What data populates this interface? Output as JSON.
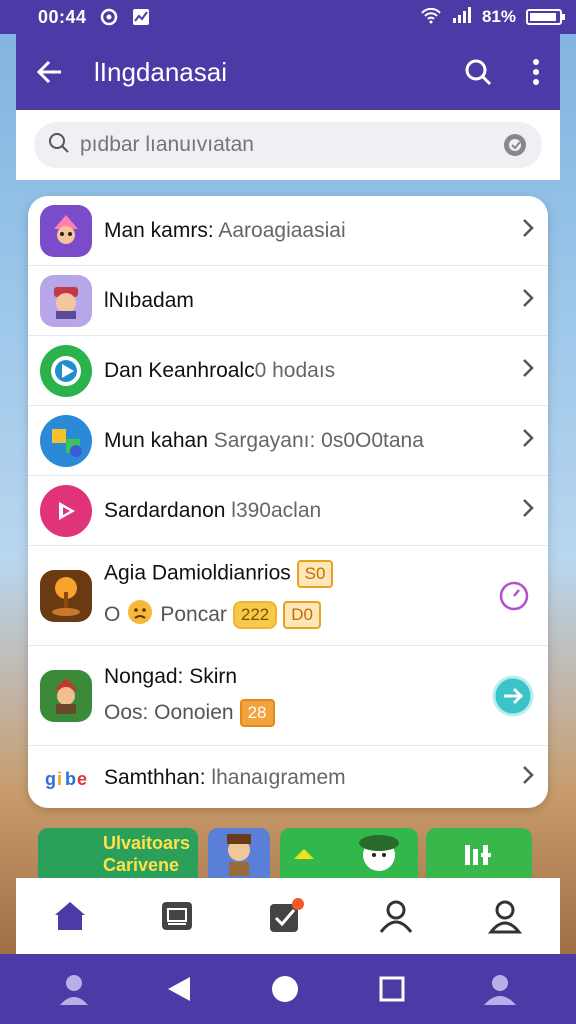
{
  "status_bar": {
    "time": "00:44",
    "battery": "81%"
  },
  "app_bar": {
    "title": "lIngdanasai"
  },
  "search": {
    "placeholder": "pıdbar lıanuıvıatan"
  },
  "list": [
    {
      "title": "Man kamrs:",
      "subtitle": "Aaroagiaasiai",
      "icon": "wizard-game-icon",
      "color": "#7a4cc9"
    },
    {
      "title": "lNıbadam",
      "subtitle": "",
      "icon": "warrior-game-icon",
      "color": "#9a7fd6"
    },
    {
      "title": "Dan Keanhroalc",
      "subtitle": "0 hodaıs",
      "icon": "play-circle-icon",
      "color": "#2bb24c"
    },
    {
      "title": "Mun kahan",
      "subtitle": "Sargayanı: 0s0O0tana",
      "icon": "puzzle-game-icon",
      "color": "#2b8ad8"
    },
    {
      "title": "Sardardanon",
      "subtitle": "l390aclan",
      "icon": "video-play-icon",
      "color": "#e0337a"
    },
    {
      "title": "Agia Damioldianrios",
      "badge": "S0",
      "line2_prefix": "O",
      "line2_text": "Poncar",
      "badge2": "222",
      "badge3": "D0",
      "icon": "tree-game-icon",
      "color": "#8a4a16",
      "action": "timer-icon"
    },
    {
      "title": "Nongad: Skirn",
      "line2_text": "Oos: Oonoien",
      "badge3": "28",
      "icon": "hero-game-icon",
      "color": "#3a8a3a",
      "action": "arrow-right-circle-icon"
    },
    {
      "title": "Samthhan:",
      "subtitle": "lhanaıgramem",
      "icon": "letters-game-icon",
      "color": "#ffffff"
    }
  ],
  "thumbnails": [
    {
      "label": "Ulvaitoars\nCarivene",
      "color": "#2aa05a"
    },
    {
      "label": "",
      "color": "#5a7fd6"
    },
    {
      "label": "",
      "color": "#32b84a"
    },
    {
      "label": "",
      "color": "#38b84a"
    }
  ],
  "bottom_nav": [
    "home-icon",
    "tv-icon",
    "tasks-icon",
    "profile-icon",
    "account-icon"
  ],
  "colors": {
    "primary": "#4d3aa6",
    "accent_teal": "#3ac3c9",
    "accent_purple": "#b44fd0"
  }
}
